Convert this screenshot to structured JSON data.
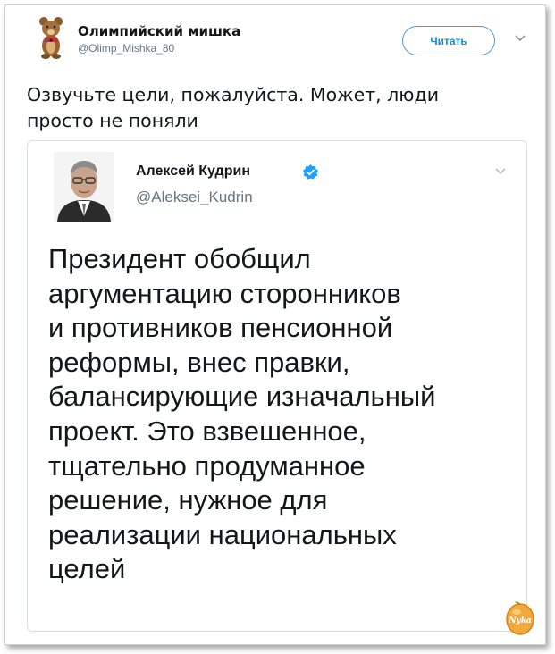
{
  "post": {
    "author_name": "Олимпийский мишка",
    "author_handle": "@Olimp_Mishka_80",
    "follow_label": "Читать",
    "text_lines": [
      "Озвучьте цели, пожалуйста. Может, люди",
      "просто не поняли"
    ]
  },
  "quoted": {
    "author_name": "Алексей Кудрин",
    "author_handle": "@Aleksei_Kudrin",
    "text_lines": [
      "Президент обобщил",
      "аргументацию сторонников",
      "и противников пенсионной",
      "реформы, внес правки,",
      "балансирующие изначальный",
      "проект. Это взвешенное,",
      "тщательно продуманное",
      "решение, нужное для",
      "реализации национальных",
      "целей"
    ]
  },
  "watermark": {
    "text": "Nyka"
  },
  "icons": {
    "avatar": "olympic-bear-avatar",
    "follow_menu": "chevron-down-icon",
    "verified": "verified-badge-icon",
    "quoted_menu": "chevron-down-icon"
  },
  "colors": {
    "accent": "#1d8ad6",
    "verified": "#1da1f2",
    "muted": "#657786",
    "watermark": "#e8961a"
  }
}
